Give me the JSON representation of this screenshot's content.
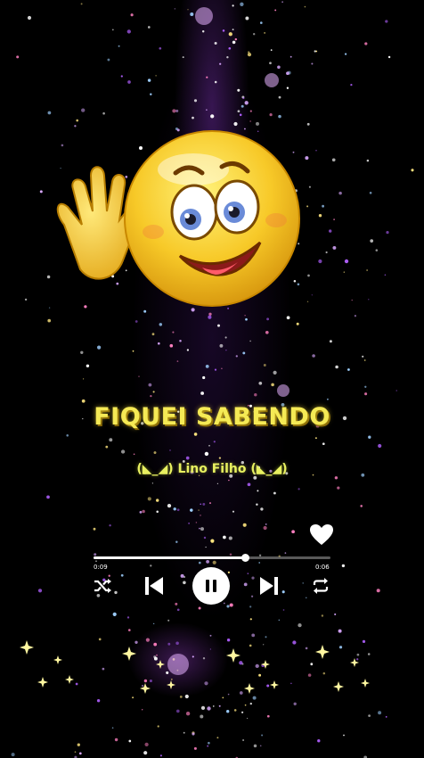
{
  "song": {
    "title": "FIQUEI SABENDO",
    "artist": "(◣_◢) Lino Filho (◣_◢)"
  },
  "player": {
    "elapsed": "0:09",
    "remaining": "0:06",
    "progress": 0.64,
    "liked": true,
    "state": "playing"
  },
  "icons": {
    "emoji": "waving-smiley-emoji",
    "like": "heart-icon",
    "shuffle": "shuffle-icon",
    "previous": "skip-previous-icon",
    "pause": "pause-icon",
    "next": "skip-next-icon",
    "repeat": "repeat-icon"
  },
  "colors": {
    "background": "#000000",
    "title": "#f5ea55",
    "artist": "#e8f060",
    "controls": "#ffffff",
    "sparkle": "#c070ff"
  }
}
